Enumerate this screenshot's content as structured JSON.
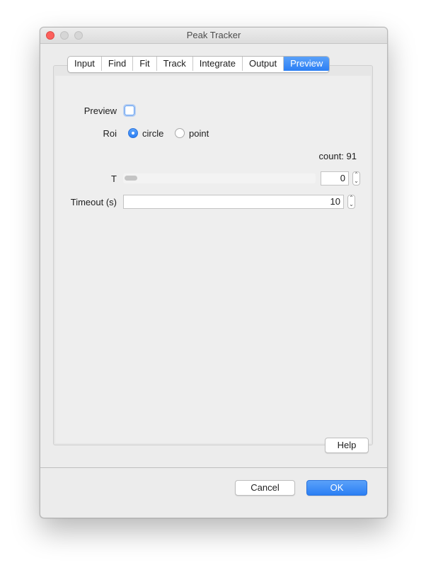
{
  "window": {
    "title": "Peak Tracker"
  },
  "tabs": [
    "Input",
    "Find",
    "Fit",
    "Track",
    "Integrate",
    "Output",
    "Preview"
  ],
  "active_tab": "Preview",
  "preview": {
    "preview_label": "Preview",
    "preview_checked": false,
    "roi_label": "Roi",
    "roi_options": [
      "circle",
      "point"
    ],
    "roi_selected": "circle",
    "count_text": "count: 91",
    "t_label": "T",
    "t_value": "0",
    "t_slider_fraction": 0,
    "timeout_label": "Timeout (s)",
    "timeout_value": "10"
  },
  "buttons": {
    "help": "Help",
    "cancel": "Cancel",
    "ok": "OK"
  },
  "colors": {
    "accent": "#2b7ff4",
    "close": "#fc605c",
    "background": "#ececec"
  }
}
